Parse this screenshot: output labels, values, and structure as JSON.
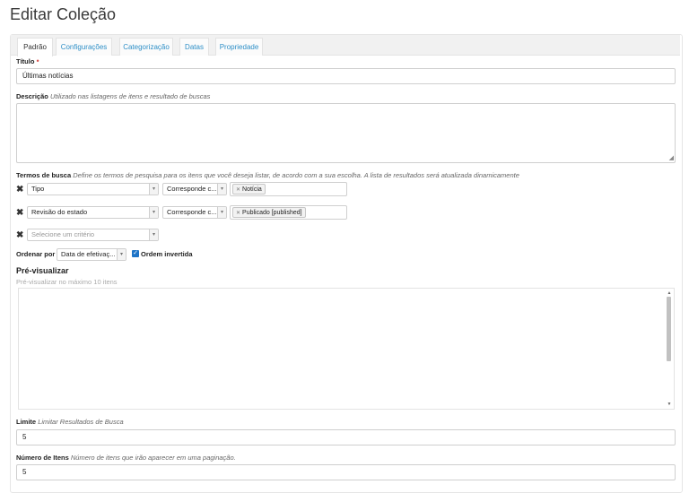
{
  "page_title": "Editar Coleção",
  "tabs": [
    {
      "label": "Padrão"
    },
    {
      "label": "Configurações"
    },
    {
      "label": "Categorização"
    },
    {
      "label": "Datas"
    },
    {
      "label": "Propriedade"
    }
  ],
  "active_tab": "Padrão",
  "title_field": {
    "label": "Título",
    "required_marker": "•",
    "value": "Últimas notícias"
  },
  "description_field": {
    "label": "Descrição",
    "help": "Utilizado nas listagens de itens e resultado de buscas",
    "value": ""
  },
  "search_terms": {
    "label": "Termos de busca",
    "help": "Define os termos de pesquisa para os itens que você deseja listar, de acordo com a sua escolha. A lista de resultados será atualizada dinamicamente",
    "remove_icon": "✖",
    "criteria": [
      {
        "field": "Tipo",
        "operator": "Corresponde c...",
        "values": [
          "Notícia"
        ]
      },
      {
        "field": "Revisão do estado",
        "operator": "Corresponde c...",
        "values": [
          "Publicado [published]"
        ]
      }
    ],
    "new_criterion_placeholder": "Selecione um critério"
  },
  "sort": {
    "label": "Ordenar por",
    "value": "Data de efetivaç...",
    "reverse_label": "Ordem invertida",
    "reverse_checked": true
  },
  "preview": {
    "title": "Pré-visualizar",
    "help": "Pré-visualizar no máximo 10 itens"
  },
  "limit": {
    "label": "Limite",
    "help": "Limitar Resultados de Busca",
    "value": "5"
  },
  "items_count": {
    "label": "Número de Itens",
    "help": "Número de itens que irão aparecer em uma paginação.",
    "value": "5"
  },
  "colors": {
    "link": "#2e8fc7",
    "required": "#d9534f",
    "checkbox": "#1e74c7"
  }
}
